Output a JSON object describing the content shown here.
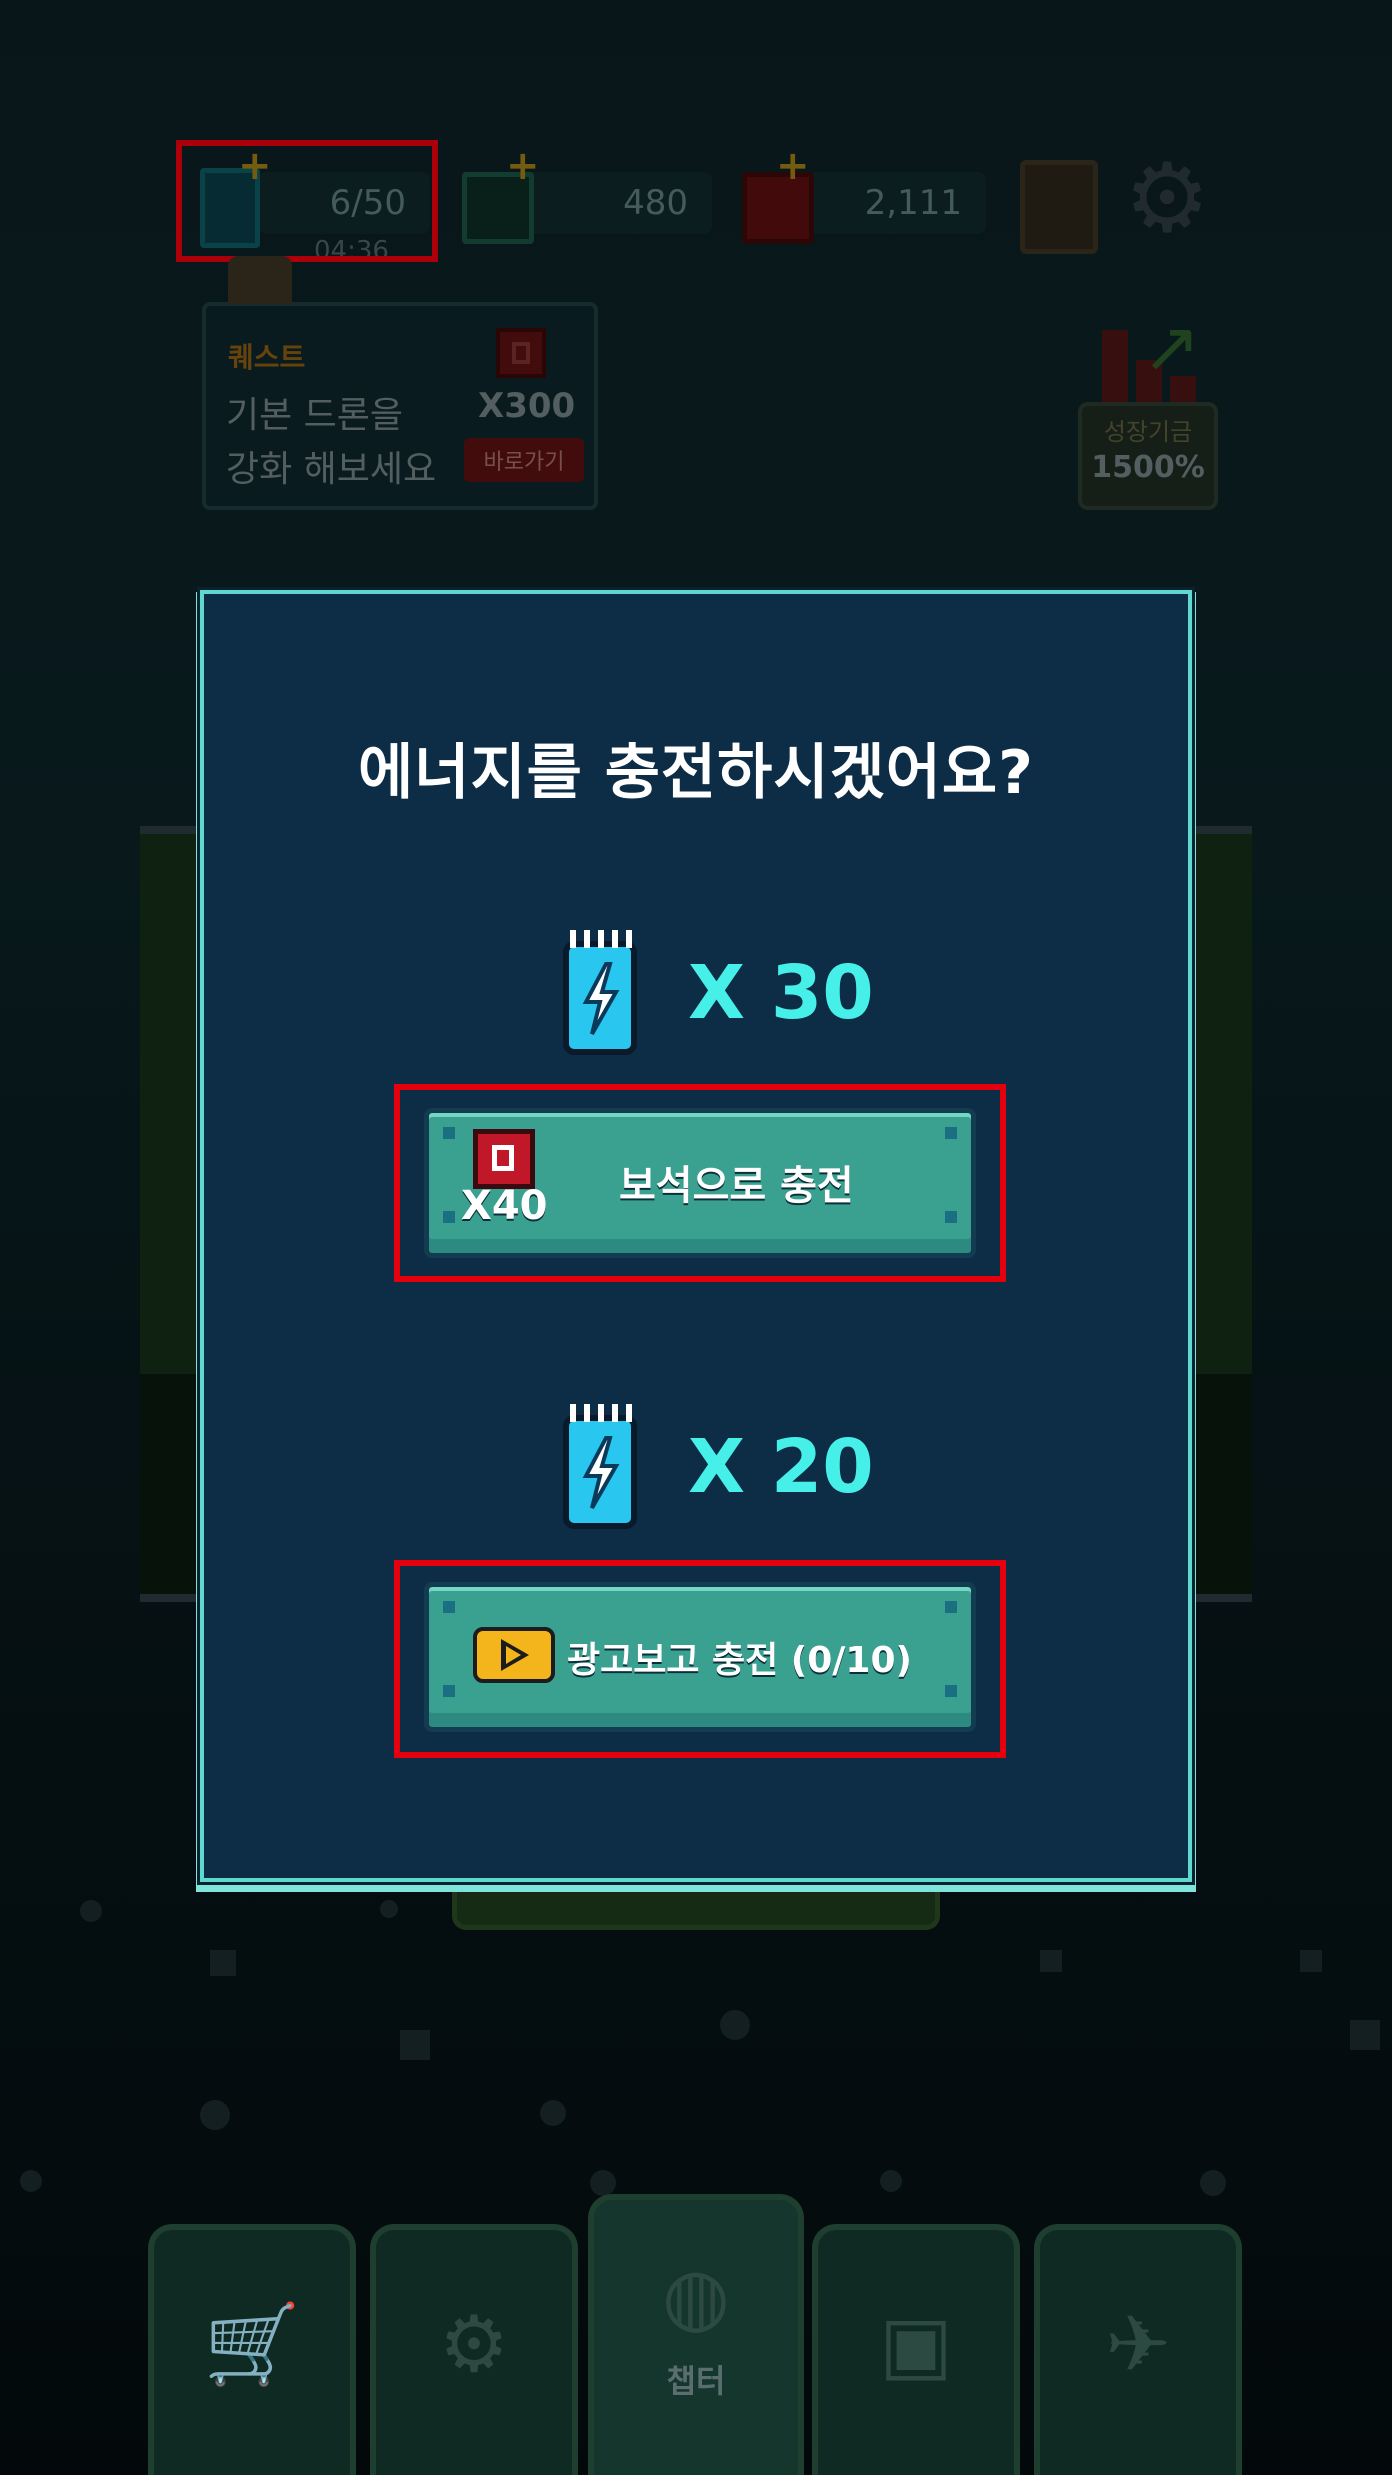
{
  "top_bar": {
    "energy": {
      "value": "6/50",
      "timer": "04:36"
    },
    "chips": {
      "value": "480"
    },
    "gems": {
      "value": "2,111"
    }
  },
  "quest": {
    "title": "퀘스트",
    "line1": "기본 드론을",
    "line2": "강화 해보세요",
    "reward": "X300",
    "go_label": "바로가기"
  },
  "growth_fund": {
    "label": "성장기금",
    "value": "1500%"
  },
  "modal": {
    "title": "에너지를 충전하시겠어요?",
    "option1": {
      "amount": "X 30",
      "cost": "X40",
      "button_label": "보석으로 충전"
    },
    "option2": {
      "amount": "X 20",
      "button_label": "광고보고 충전 (0/10)"
    }
  },
  "nav": {
    "tabs": [
      {
        "icon": "shop-cart-icon",
        "label": ""
      },
      {
        "icon": "robot-arm-icon",
        "label": ""
      },
      {
        "icon": "globe-icon",
        "label": "챕터"
      },
      {
        "icon": "chip-icon",
        "label": ""
      },
      {
        "icon": "drone-icon",
        "label": ""
      }
    ]
  },
  "colors": {
    "accent": "#46f0e8",
    "highlight": "#e5000d",
    "button": "#3aa090",
    "modal_bg": "#0c2d45"
  }
}
